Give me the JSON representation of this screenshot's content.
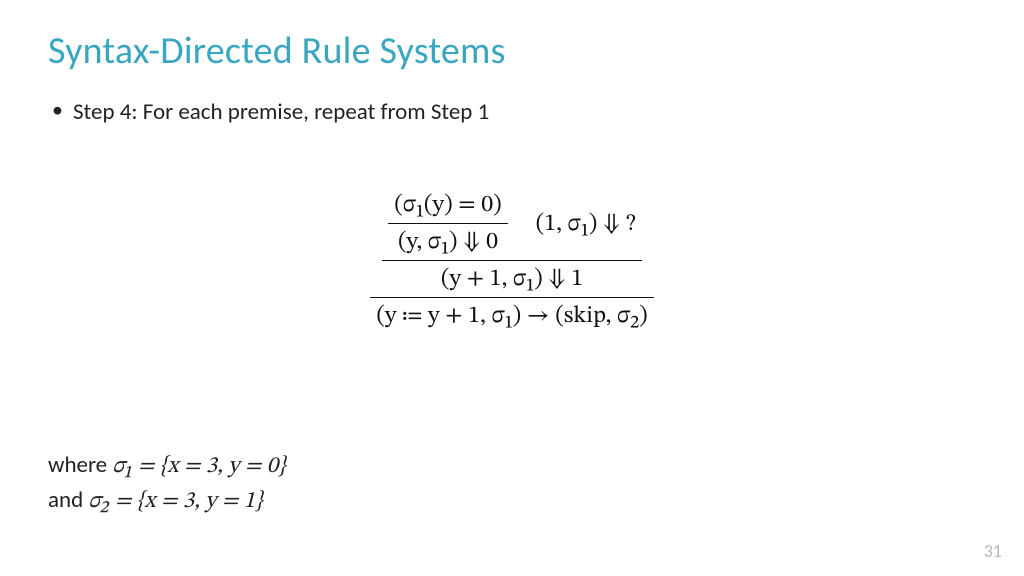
{
  "title": "Syntax-Directed Rule Systems",
  "bullet": "Step 4: For each premise, repeat from Step 1",
  "derivation": {
    "top_num": "(σ₁(y) = 0)",
    "top_den": "(y, σ₁) ⇓ 0",
    "top_side": "(1, σ₁) ⇓ ?",
    "mid_den": "(y + 1, σ₁) ⇓ 1",
    "bot_den": "(y ≔ y + 1, σ₁) → (skip, σ₂)"
  },
  "footer": {
    "line1_prefix": "where ",
    "line1_math": "σ₁ = {x = 3, y = 0}",
    "line2_prefix": "and ",
    "line2_math": "σ₂ = {x = 3, y = 1}"
  },
  "page_number": "31"
}
